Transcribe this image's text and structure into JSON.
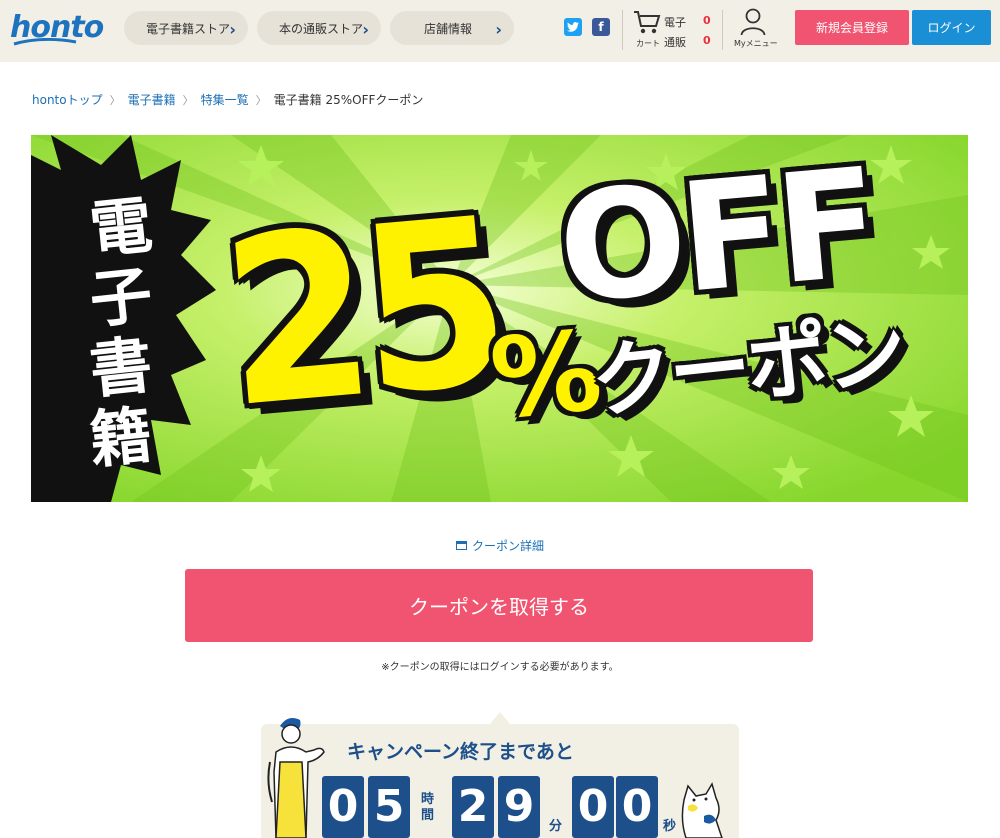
{
  "header": {
    "logo": "honto",
    "nav": [
      {
        "label": "電子書籍ストア"
      },
      {
        "label": "本の通販ストア"
      },
      {
        "label": "店舗情報"
      }
    ],
    "social": {
      "twitter": "t",
      "facebook": "f"
    },
    "cart": {
      "label": "カート",
      "rows": [
        {
          "label": "電子",
          "count": "0"
        },
        {
          "label": "通販",
          "count": "0"
        }
      ]
    },
    "my_menu_label": "Myメニュー",
    "register_label": "新規会員登録",
    "login_label": "ログイン"
  },
  "breadcrumb": {
    "items": [
      "hontoトップ",
      "電子書籍",
      "特集一覧"
    ],
    "current": "電子書籍 25%OFFクーポン"
  },
  "banner": {
    "vertical_text": [
      "電",
      "子",
      "書",
      "籍"
    ],
    "big_number": "25",
    "percent": "%",
    "off": "OFF",
    "coupon": "クーポン",
    "colors": {
      "green": "#8ddc2f",
      "yellow": "#fff200",
      "black": "#111111"
    }
  },
  "coupon": {
    "detail_label": "クーポン詳細",
    "get_label": "クーポンを取得する",
    "note": "※クーポンの取得にはログインする必要があります。"
  },
  "countdown": {
    "title": "キャンペーン終了まであと",
    "hours": [
      "0",
      "5"
    ],
    "minutes": [
      "2",
      "9"
    ],
    "seconds": [
      "0",
      "0"
    ],
    "hour_unit": "時間",
    "minute_unit": "分",
    "second_unit": "秒"
  },
  "colors": {
    "accent_pink": "#f05470",
    "accent_blue": "#1a8fd6",
    "navy": "#1d4f8a",
    "link": "#1a6fb5"
  }
}
